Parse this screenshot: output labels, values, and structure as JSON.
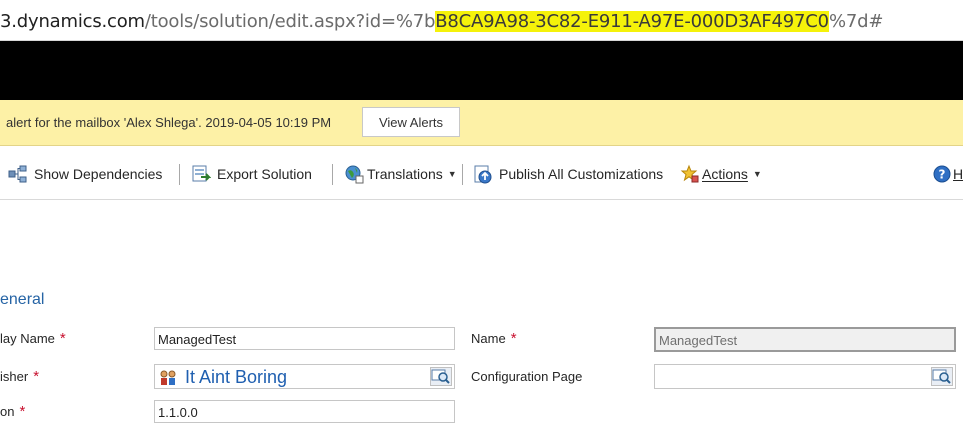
{
  "browser": {
    "url_host": "3.dynamics.com",
    "url_path": "/tools/solution/edit.aspx?id=%7b",
    "url_highlighted": "B8CA9A98-3C82-E911-A97E-000D3AF497C0",
    "url_suffix": "%7d#"
  },
  "alert": {
    "message": "alert for the mailbox 'Alex Shlega'. 2019-04-05 10:19 PM",
    "button_label": "View Alerts",
    "bg_color": "#fdf1a6"
  },
  "toolbar": {
    "show_dependencies": "Show Dependencies",
    "export_solution": "Export Solution",
    "translations": "Translations",
    "publish_all": "Publish All Customizations",
    "actions": "Actions",
    "help": "H"
  },
  "form": {
    "section_title": "eneral",
    "display_name_label": "lay Name",
    "display_name_value": "ManagedTest",
    "name_label": "Name",
    "name_value": "ManagedTest",
    "publisher_label": "isher",
    "publisher_value": "It Aint Boring",
    "config_page_label": "Configuration Page",
    "config_page_value": "",
    "version_label": "on",
    "version_value": "1.1.0.0",
    "required_mark": "*"
  },
  "colors": {
    "accent": "#2664a5",
    "required": "#c8102e",
    "url_highlight": "#f5f20a"
  }
}
